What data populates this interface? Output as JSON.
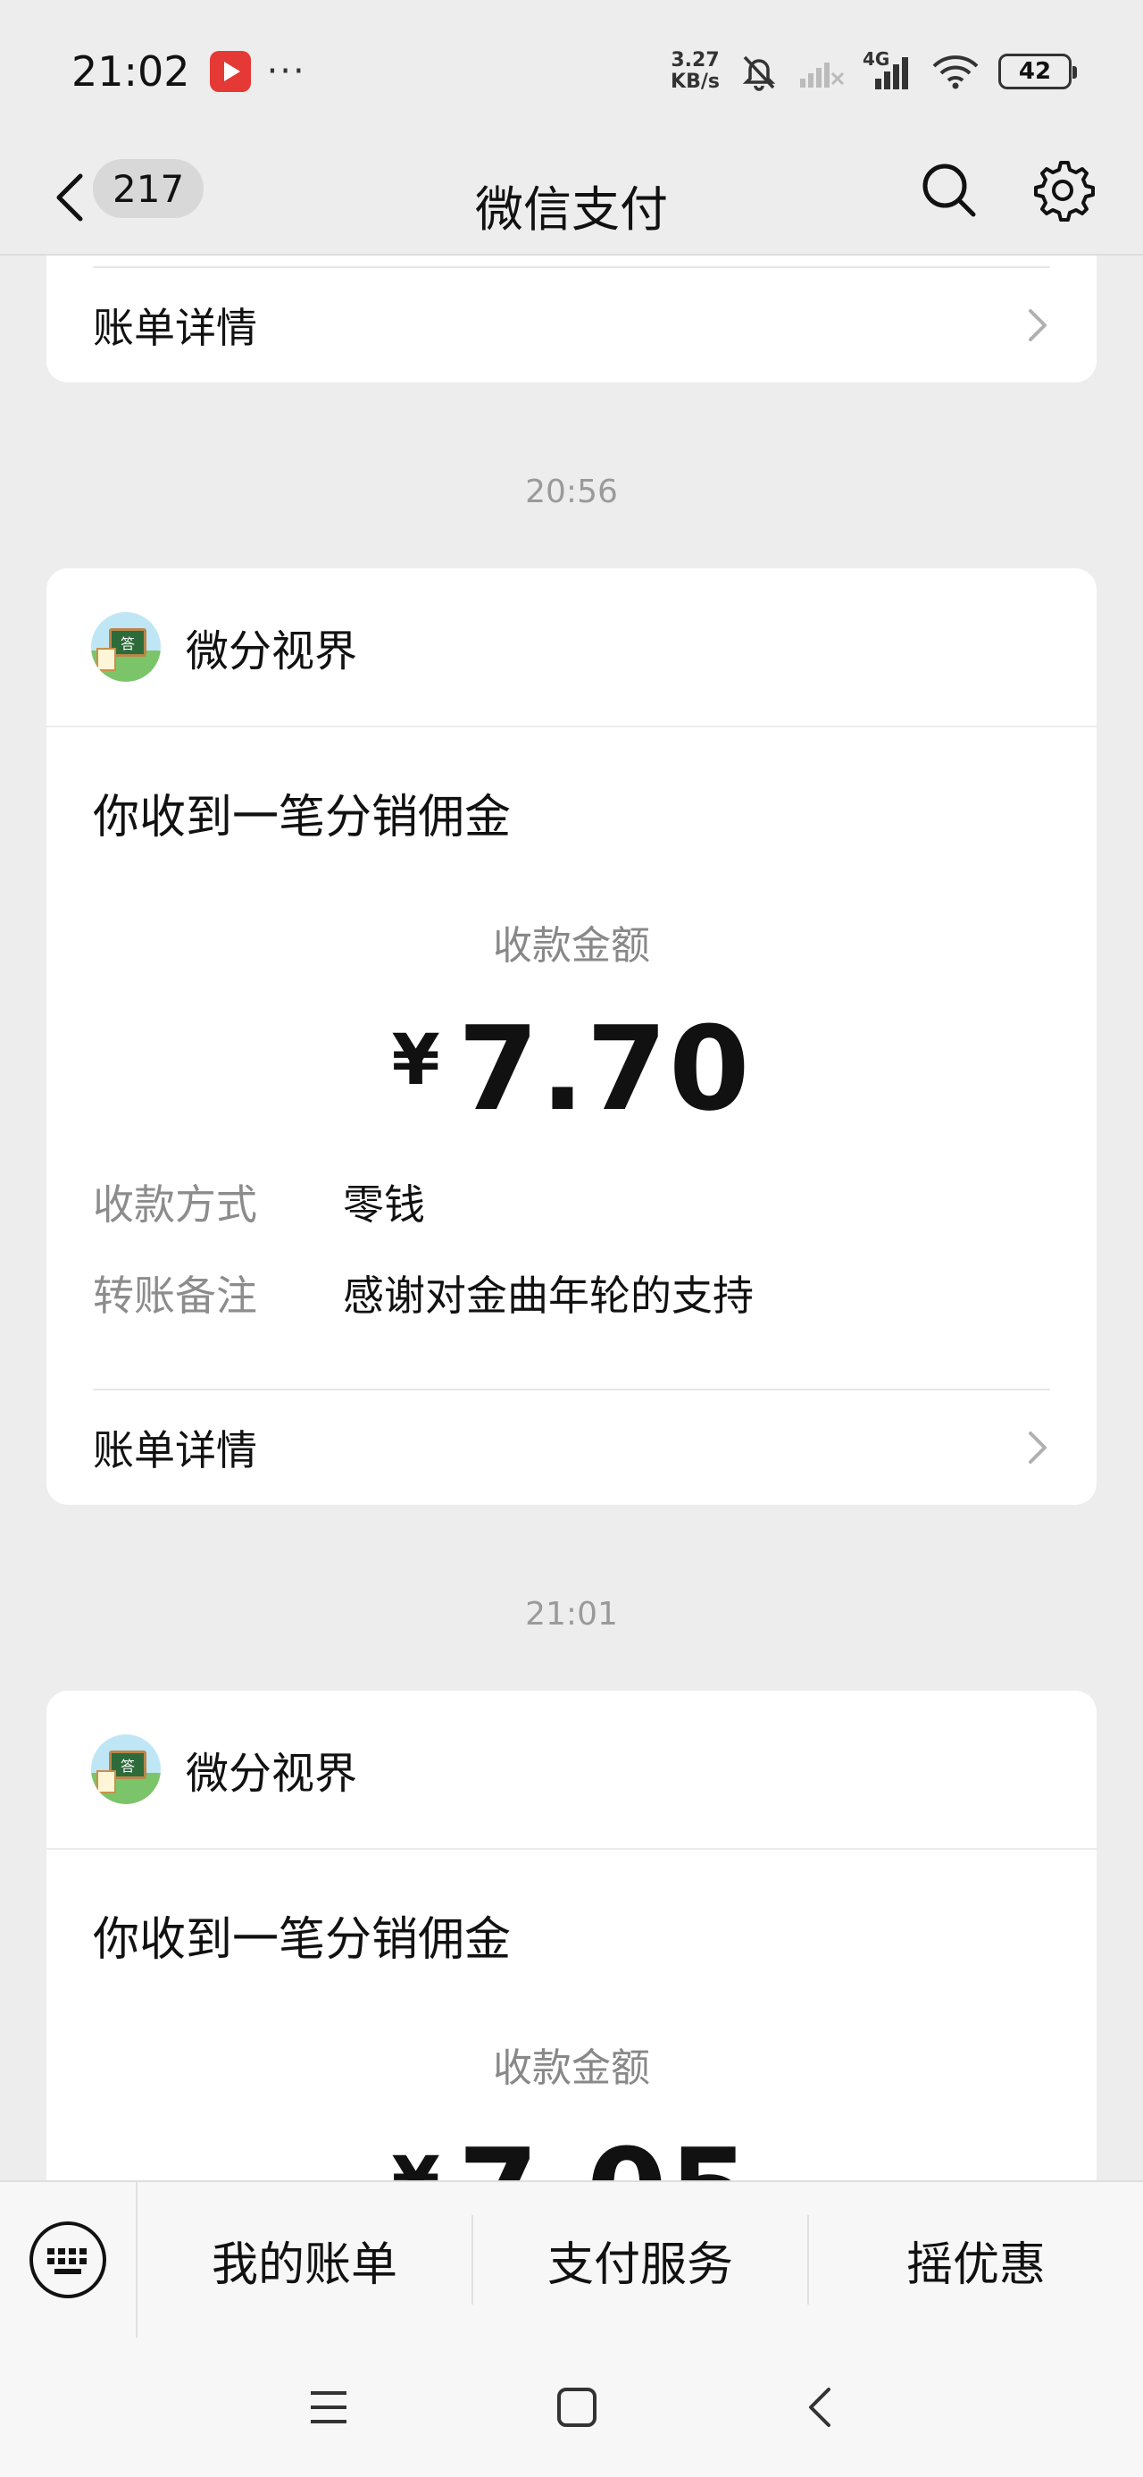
{
  "status_bar": {
    "time": "21:02",
    "more": "···",
    "net_speed_value": "3.27",
    "net_speed_unit": "KB/s",
    "network_type": "4G",
    "battery": "42"
  },
  "nav": {
    "unread_count": "217",
    "title": "微信支付"
  },
  "feed": {
    "top_card": {
      "bill_details_label": "账单详情"
    },
    "messages": [
      {
        "time": "20:56",
        "sender": "微分视界",
        "subject": "你收到一笔分销佣金",
        "amount_label": "收款金额",
        "currency": "¥",
        "amount": "7.70",
        "method_label": "收款方式",
        "method_value": "零钱",
        "note_label": "转账备注",
        "note_value": "感谢对金曲年轮的支持",
        "bill_details_label": "账单详情"
      },
      {
        "time": "21:01",
        "sender": "微分视界",
        "subject": "你收到一笔分销佣金",
        "amount_label": "收款金额",
        "currency": "¥",
        "amount": "7.05"
      }
    ]
  },
  "avatar_glyph": "答",
  "menu": {
    "items": [
      "我的账单",
      "支付服务",
      "摇优惠"
    ]
  },
  "colors": {
    "background": "#ededed",
    "card": "#ffffff",
    "secondary_text": "#8c8c8c"
  }
}
